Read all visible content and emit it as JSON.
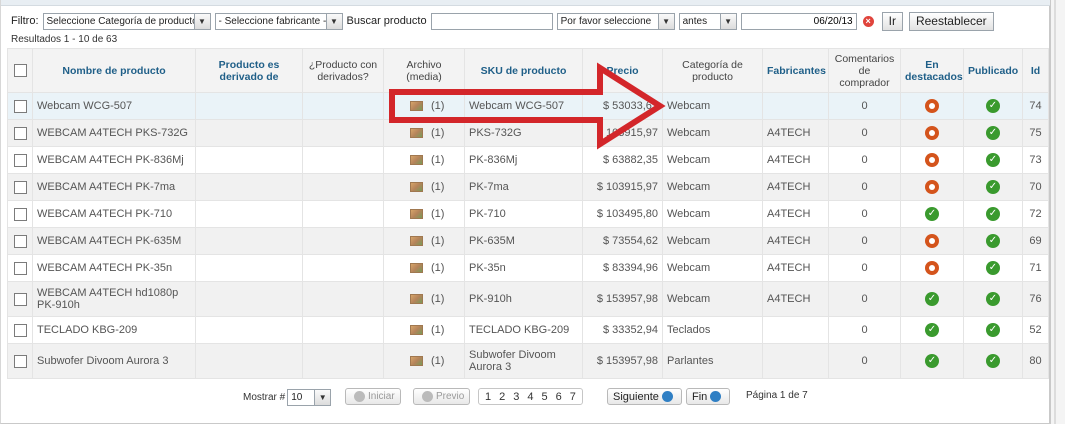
{
  "filter": {
    "label": "Filtro:",
    "category_select": "Seleccione Categoría de producto",
    "maker_select": "- Seleccione fabricante -",
    "search_label": "Buscar producto",
    "search_value": "",
    "cond_select": "Por favor seleccione",
    "date_op_select": "antes",
    "date_value": "06/20/13",
    "go_label": "Ir",
    "reset_label": "Reestablecer"
  },
  "results_text": "Resultados 1 - 10 de 63",
  "table": {
    "headers": {
      "name": "Nombre de producto",
      "derived_from": "Producto es derivado de",
      "has_derived": "¿Producto con derivados?",
      "file": "Archivo (media)",
      "sku": "SKU de producto",
      "price": "Precio",
      "category": "Categoría de producto",
      "maker": "Fabricantes",
      "reviews": "Comentarios de comprador",
      "featured": "En destacados",
      "published": "Publicado",
      "id": "Id"
    },
    "rows": [
      {
        "name": "Webcam WCG-507",
        "file": "(1)",
        "sku": "Webcam WCG-507",
        "price": "$ 53033,61",
        "category": "Webcam",
        "maker": "",
        "reviews": "0",
        "featured": "no",
        "published": "ok",
        "id": "74"
      },
      {
        "name": "WEBCAM A4TECH PKS-732G",
        "file": "(1)",
        "sku": "PKS-732G",
        "price": "$ 103915,97",
        "category": "Webcam",
        "maker": "A4TECH",
        "reviews": "0",
        "featured": "no",
        "published": "ok",
        "id": "75"
      },
      {
        "name": "WEBCAM A4TECH PK-836Mj",
        "file": "(1)",
        "sku": "PK-836Mj",
        "price": "$ 63882,35",
        "category": "Webcam",
        "maker": "A4TECH",
        "reviews": "0",
        "featured": "no",
        "published": "ok",
        "id": "73"
      },
      {
        "name": "WEBCAM A4TECH PK-7ma",
        "file": "(1)",
        "sku": "PK-7ma",
        "price": "$ 103915,97",
        "category": "Webcam",
        "maker": "A4TECH",
        "reviews": "0",
        "featured": "no",
        "published": "ok",
        "id": "70"
      },
      {
        "name": "WEBCAM A4TECH PK-710",
        "file": "(1)",
        "sku": "PK-710",
        "price": "$ 103495,80",
        "category": "Webcam",
        "maker": "A4TECH",
        "reviews": "0",
        "featured": "ok",
        "published": "ok",
        "id": "72"
      },
      {
        "name": "WEBCAM A4TECH PK-635M",
        "file": "(1)",
        "sku": "PK-635M",
        "price": "$ 73554,62",
        "category": "Webcam",
        "maker": "A4TECH",
        "reviews": "0",
        "featured": "no",
        "published": "ok",
        "id": "69"
      },
      {
        "name": "WEBCAM A4TECH PK-35n",
        "file": "(1)",
        "sku": "PK-35n",
        "price": "$ 83394,96",
        "category": "Webcam",
        "maker": "A4TECH",
        "reviews": "0",
        "featured": "no",
        "published": "ok",
        "id": "71"
      },
      {
        "name": "WEBCAM A4TECH hd1080p PK-910h",
        "file": "(1)",
        "sku": "PK-910h",
        "price": "$ 153957,98",
        "category": "Webcam",
        "maker": "A4TECH",
        "reviews": "0",
        "featured": "ok",
        "published": "ok",
        "id": "76"
      },
      {
        "name": "TECLADO KBG-209",
        "file": "(1)",
        "sku": "TECLADO KBG-209",
        "price": "$ 33352,94",
        "category": "Teclados",
        "maker": "",
        "reviews": "0",
        "featured": "ok",
        "published": "ok",
        "id": "52"
      },
      {
        "name": "Subwofer Divoom Aurora 3",
        "file": "(1)",
        "sku": "Subwofer Divoom Aurora 3",
        "price": "$ 153957,98",
        "category": "Parlantes",
        "maker": "",
        "reviews": "0",
        "featured": "ok",
        "published": "ok",
        "id": "80"
      }
    ]
  },
  "pager": {
    "show_label": "Mostrar #",
    "show_value": "10",
    "first": "Iniciar",
    "prev": "Previo",
    "pages": [
      "1",
      "2",
      "3",
      "4",
      "5",
      "6",
      "7"
    ],
    "next": "Siguiente",
    "last": "Fin",
    "info": "Página 1 de 7"
  },
  "colors": {
    "link": "#2a6e98",
    "published_ok": "#3a9a2e",
    "featured_no": "#d4541c",
    "arrow": "#d3262a"
  }
}
